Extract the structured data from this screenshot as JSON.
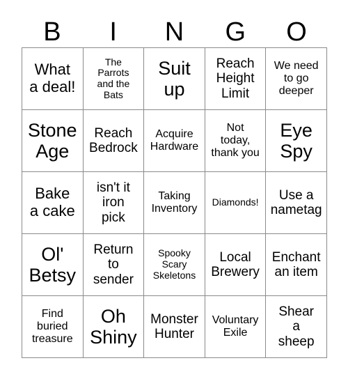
{
  "card": {
    "headers": [
      "B",
      "I",
      "N",
      "G",
      "O"
    ],
    "rows": [
      [
        {
          "text": "What\na deal!",
          "size": "lg"
        },
        {
          "text": "The\nParrots\nand the\nBats",
          "size": "xs"
        },
        {
          "text": "Suit\nup",
          "size": "xl"
        },
        {
          "text": "Reach\nHeight\nLimit",
          "size": "md"
        },
        {
          "text": "We need\nto go\ndeeper",
          "size": "sm"
        }
      ],
      [
        {
          "text": "Stone\nAge",
          "size": "xl"
        },
        {
          "text": "Reach\nBedrock",
          "size": "md"
        },
        {
          "text": "Acquire\nHardware",
          "size": "sm"
        },
        {
          "text": "Not\ntoday,\nthank you",
          "size": "sm"
        },
        {
          "text": "Eye\nSpy",
          "size": "xl"
        }
      ],
      [
        {
          "text": "Bake\na cake",
          "size": "lg"
        },
        {
          "text": "isn't it\niron\npick",
          "size": "md"
        },
        {
          "text": "Taking\nInventory",
          "size": "sm"
        },
        {
          "text": "Diamonds!",
          "size": "xs"
        },
        {
          "text": "Use a\nnametag",
          "size": "md"
        }
      ],
      [
        {
          "text": "Ol'\nBetsy",
          "size": "xl"
        },
        {
          "text": "Return\nto\nsender",
          "size": "md"
        },
        {
          "text": "Spooky\nScary\nSkeletons",
          "size": "xs"
        },
        {
          "text": "Local\nBrewery",
          "size": "md"
        },
        {
          "text": "Enchant\nan item",
          "size": "md"
        }
      ],
      [
        {
          "text": "Find\nburied\ntreasure",
          "size": "sm"
        },
        {
          "text": "Oh\nShiny",
          "size": "xl"
        },
        {
          "text": "Monster\nHunter",
          "size": "md"
        },
        {
          "text": "Voluntary\nExile",
          "size": "sm"
        },
        {
          "text": "Shear\na\nsheep",
          "size": "md"
        }
      ]
    ]
  },
  "colors": {
    "grid_line": "#8a8a8a",
    "text": "#000000",
    "background": "#ffffff"
  }
}
